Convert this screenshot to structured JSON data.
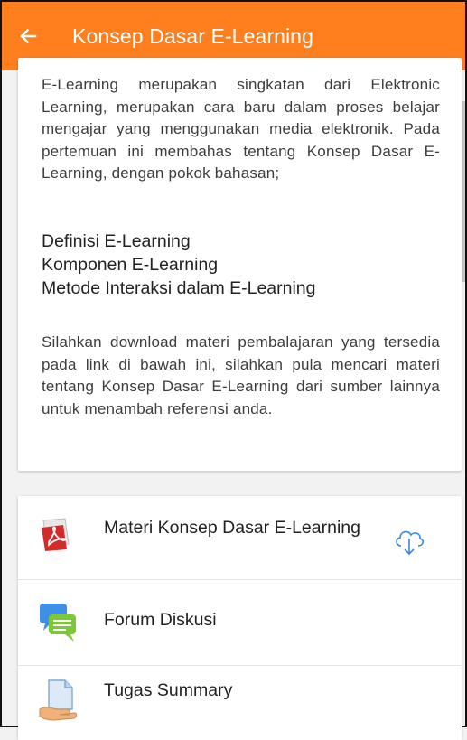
{
  "header": {
    "title": "Konsep Dasar E-Learning",
    "back_icon": "arrow-left-icon",
    "color": "#ff7f1e"
  },
  "description": {
    "intro": "E-Learning merupakan singkatan dari Elektronic Learning, merupakan cara baru dalam proses belajar mengajar yang menggunakan media elektronik. Pada pertemuan ini membahas tentang Konsep Dasar E-Learning, dengan pokok bahasan;",
    "topics": [
      "Definisi E-Learning",
      "Komponen E-Learning",
      "Metode Interaksi dalam E-Learning"
    ],
    "outro": "Silahkan download materi pembalajaran yang tersedia pada link di bawah ini, silahkan pula mencari materi tentang Konsep Dasar E-Learning dari sumber lainnya untuk menambah referensi anda."
  },
  "activities": [
    {
      "label": "Materi Konsep Dasar E-Learning",
      "icon": "pdf-file-icon",
      "action_icon": "cloud-download-icon"
    },
    {
      "label": "Forum Diskusi",
      "icon": "forum-chat-icon"
    },
    {
      "label": "Tugas Summary",
      "icon": "assignment-hand-icon"
    }
  ]
}
